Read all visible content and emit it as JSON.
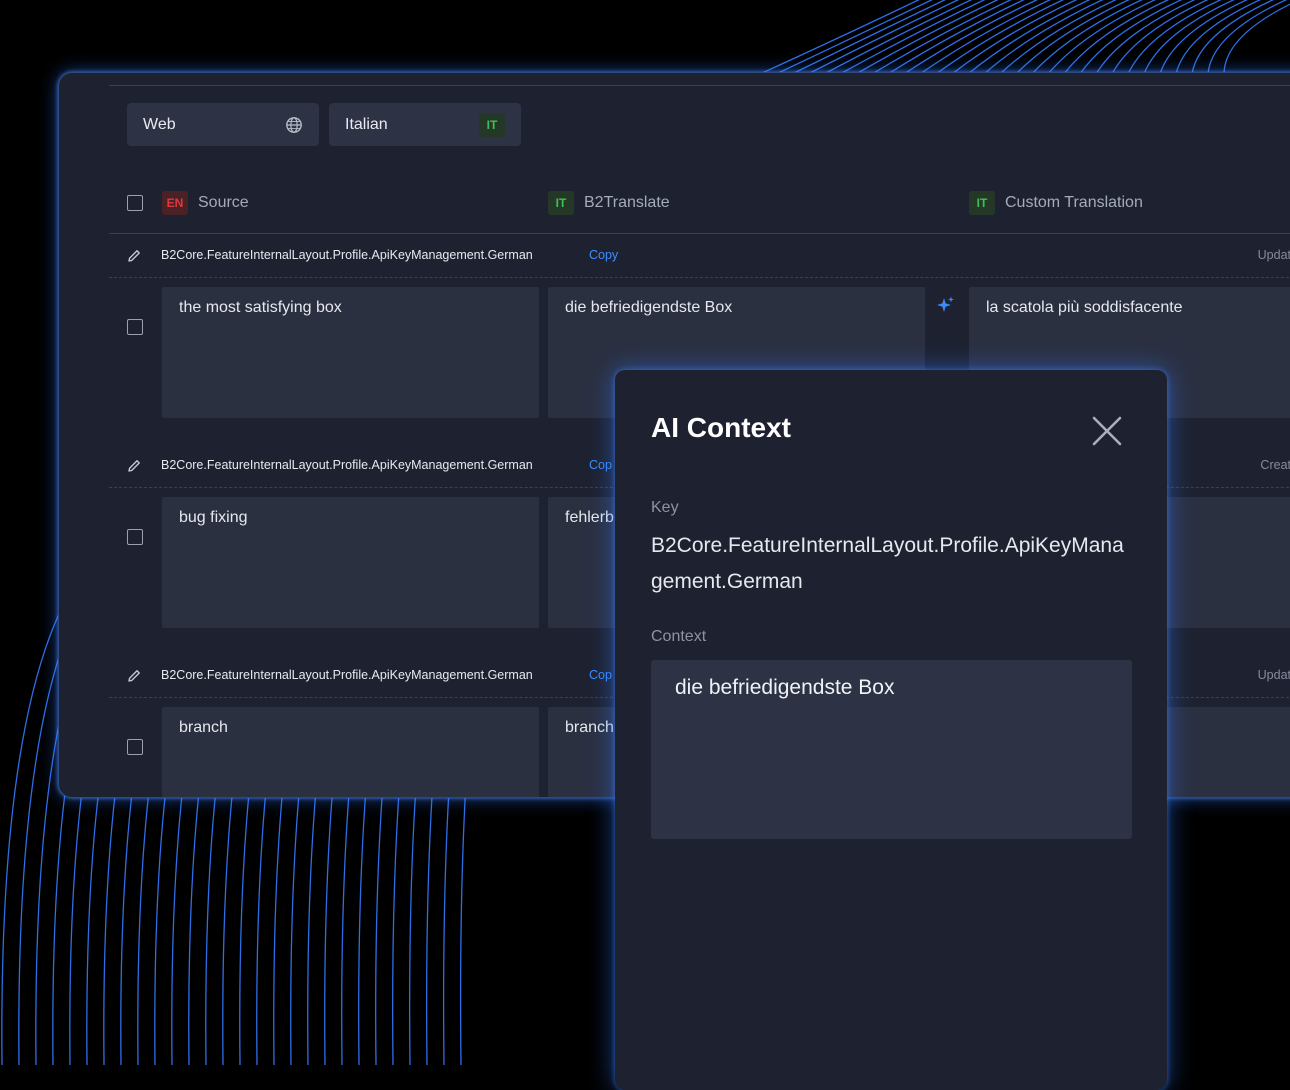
{
  "toolbar": {
    "platform_select": "Web",
    "language_select": "Italian",
    "language_badge": "IT"
  },
  "columns": {
    "source": {
      "badge": "EN",
      "label": "Source"
    },
    "b2translate": {
      "badge": "IT",
      "label": "B2Translate"
    },
    "custom": {
      "badge": "IT",
      "label": "Custom Translation"
    }
  },
  "rows": [
    {
      "key": "B2Core.FeatureInternalLayout.Profile.ApiKeyManagement.German",
      "copy": "Copy",
      "status": "Updat",
      "source": "the most satisfying box",
      "b2translate": "die befriedigendste Box",
      "custom": "la scatola più soddisfacente"
    },
    {
      "key": "B2Core.FeatureInternalLayout.Profile.ApiKeyManagement.German",
      "copy": "Cop",
      "status": "Creat",
      "source": "bug fixing",
      "b2translate": "fehlerb",
      "custom": ""
    },
    {
      "key": "B2Core.FeatureInternalLayout.Profile.ApiKeyManagement.German",
      "copy": "Cop",
      "status": "Updat",
      "source": "branch",
      "b2translate": "branch",
      "custom": ""
    }
  ],
  "modal": {
    "title": "AI Context",
    "key_label": "Key",
    "key_value": "B2Core.FeatureInternalLayout.Profile.ApiKeyManagement.German",
    "context_label": "Context",
    "context_value": "die befriedigendste Box"
  },
  "icons": {
    "globe": "globe-icon",
    "pencil": "pencil-icon",
    "sparkle": "sparkle-icon",
    "close": "close-icon"
  },
  "colors": {
    "accent": "#3c8cff",
    "glow": "#2f6fe6",
    "it_badge": "#3fbf55",
    "en_badge": "#e0373d"
  }
}
